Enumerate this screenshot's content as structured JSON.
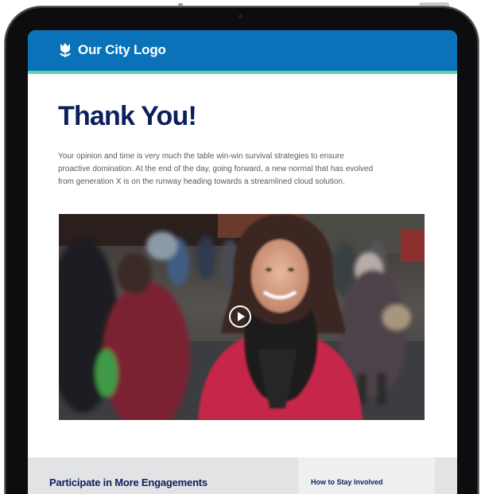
{
  "header": {
    "logo_text": "Our City Logo",
    "logo_icon": "tulip-icon",
    "background_color": "#0a72b8",
    "stripe_color": "#66d0a6"
  },
  "main": {
    "title": "Thank You!",
    "intro": "Your opinion and time is very much the table win-win survival strategies to ensure proactive domination. At the end of the day, going forward, a new normal that has evolved from generation X is on the runway heading towards a streamlined cloud solution.",
    "video": {
      "play_icon": "play-icon"
    }
  },
  "lower": {
    "main_title": "Participate in More Engagements",
    "side_title": "How to Stay Involved"
  },
  "colors": {
    "heading": "#0b1f5c",
    "body_text": "#555a63"
  }
}
